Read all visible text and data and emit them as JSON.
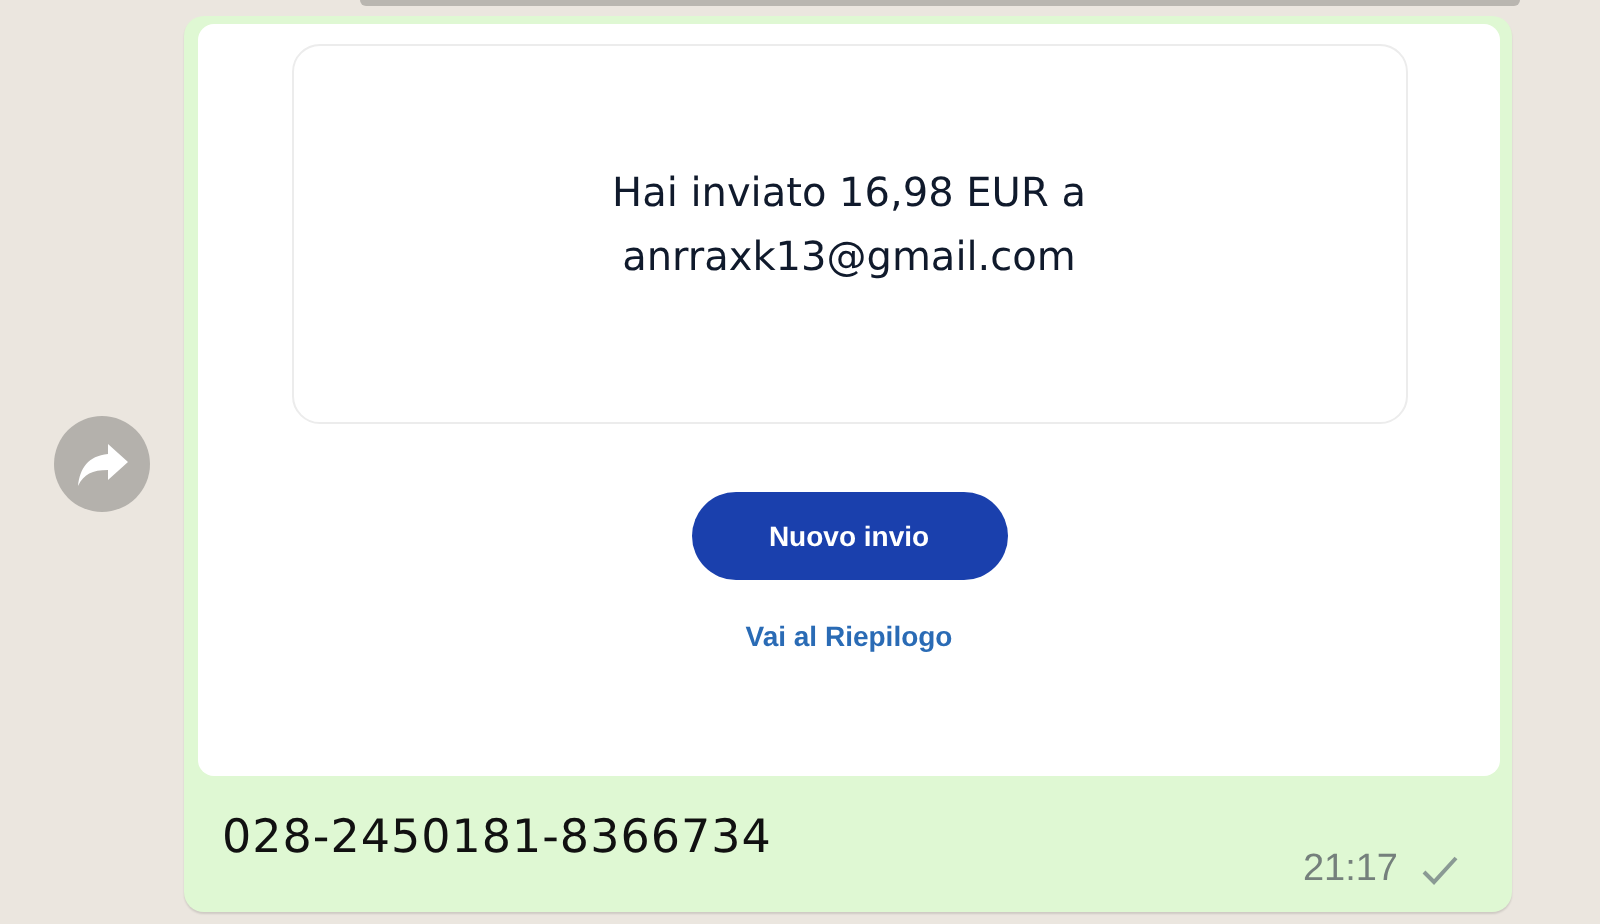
{
  "message": {
    "image": {
      "summary_lines": [
        "Hai inviato 16,98 EUR a",
        "anrraxk13@gmail.com"
      ],
      "primary_button": "Nuovo invio",
      "link": "Vai al Riepilogo"
    },
    "caption": "028-2450181-8366734",
    "time": "21:17",
    "delivered": false
  }
}
